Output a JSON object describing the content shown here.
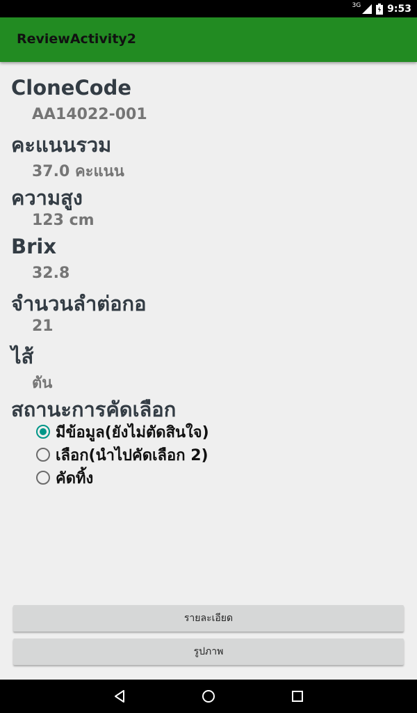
{
  "status_bar": {
    "network": "3G",
    "time": "9:53"
  },
  "app_bar": {
    "title": "ReviewActivity2"
  },
  "fields": [
    {
      "label": "CloneCode",
      "value": "AA14022-001"
    },
    {
      "label": "คะแนนรวม",
      "value": "37.0 คะแนน"
    },
    {
      "label": "ความสูง",
      "value": "123 cm"
    },
    {
      "label": "Brix",
      "value": "32.8"
    },
    {
      "label": "จำนวนลำต่อกอ",
      "value": "21"
    },
    {
      "label": "ไส้",
      "value": "ตัน"
    }
  ],
  "selection": {
    "label": "สถานะการคัดเลือก",
    "options": [
      {
        "label": "มีข้อมูล(ยังไม่ตัดสินใจ)",
        "checked": true
      },
      {
        "label": "เลือก(นำไปคัดเลือก 2)",
        "checked": false
      },
      {
        "label": "คัดทิ้ง",
        "checked": false
      }
    ]
  },
  "buttons": {
    "details": "รายละเอียด",
    "image": "รูปภาพ"
  },
  "colors": {
    "app_bar": "#228b22",
    "radio_accent": "#009688",
    "background": "#efefef"
  }
}
